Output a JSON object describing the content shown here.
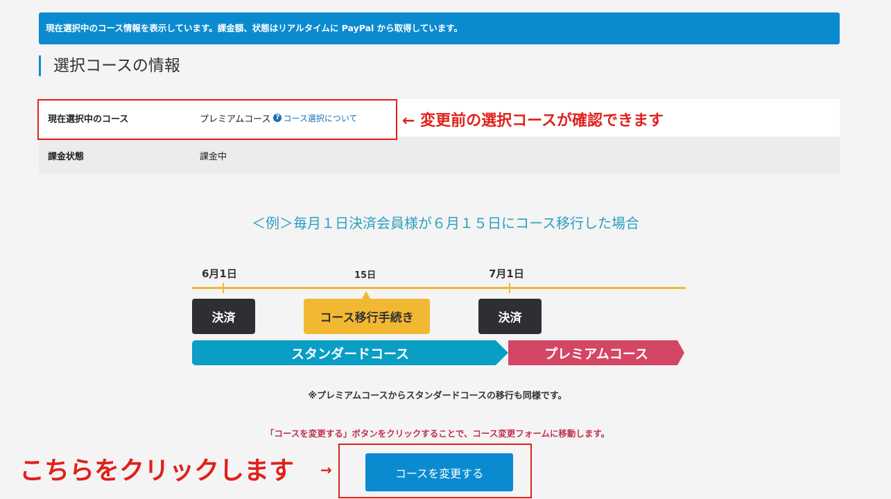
{
  "info_bar": {
    "text": "現在選択中のコース情報を表示しています。課金額、状態はリアルタイムに PayPal から取得しています。"
  },
  "section": {
    "title": "選択コースの情報"
  },
  "course_info": {
    "rows": [
      {
        "label": "現在選択中のコース",
        "value": "プレミアムコース",
        "link": "コース選択について"
      },
      {
        "label": "課金状態",
        "value": "課金中"
      }
    ]
  },
  "annotations": {
    "confirm": "← 変更前の選択コースが確認できます",
    "click_here": "こちらをクリックします",
    "click_arrow": "→"
  },
  "example": {
    "title": "＜例＞毎月１日決済会員様が６月１５日にコース移行した場合",
    "dates": {
      "start": "6月1日",
      "mid": "15日",
      "end": "7月1日"
    },
    "boxes": {
      "payment": "決済",
      "transition": "コース移行手続き"
    },
    "bars": {
      "standard": "スタンダードコース",
      "premium": "プレミアムコース"
    }
  },
  "note": "※プレミアムコースからスタンダードコースの移行も同様です。",
  "instruction": "「コースを変更する」ボタンをクリックすることで、コース変更フォームに移動します。",
  "button": {
    "label": "コースを変更する"
  },
  "colors": {
    "accent": "#0a8bd0",
    "annotation": "#e0201a",
    "timeline": "#f3b832",
    "standard": "#0a9ec4",
    "premium": "#d44665"
  }
}
